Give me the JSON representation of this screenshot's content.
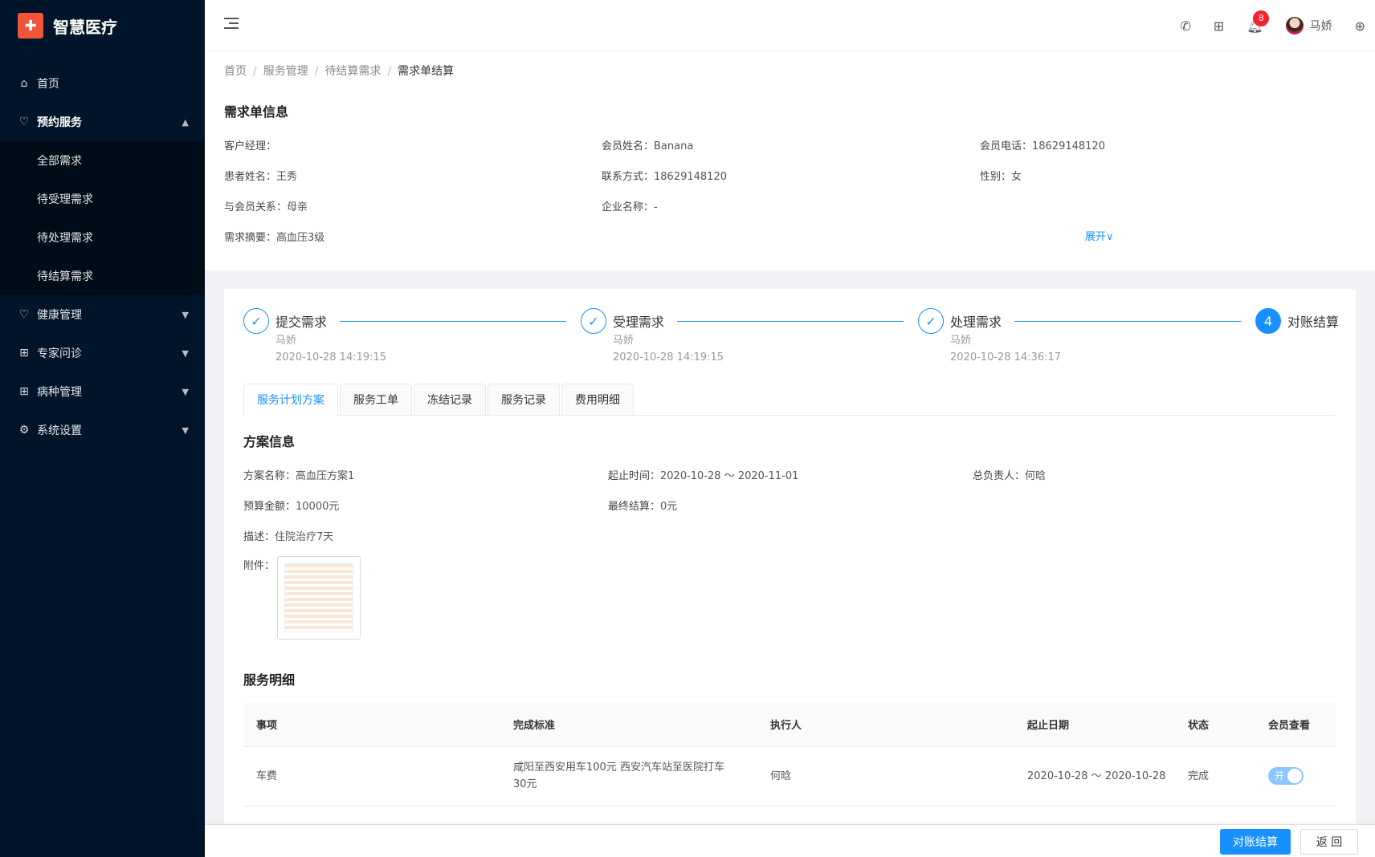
{
  "app": {
    "name": "智慧医疗"
  },
  "sidebar": {
    "items": [
      {
        "label": "首页",
        "icon": "home-icon"
      },
      {
        "label": "预约服务",
        "icon": "heart-shield-icon",
        "open": true,
        "children": [
          "全部需求",
          "待受理需求",
          "待处理需求",
          "待结算需求"
        ]
      },
      {
        "label": "健康管理",
        "icon": "heart-pulse-icon"
      },
      {
        "label": "专家问诊",
        "icon": "medical-plus-icon"
      },
      {
        "label": "病种管理",
        "icon": "medical-plus-icon"
      },
      {
        "label": "系统设置",
        "icon": "gear-icon"
      }
    ]
  },
  "header": {
    "notification_count": "8",
    "user_name": "马娇"
  },
  "breadcrumb": [
    "首页",
    "服务管理",
    "待结算需求",
    "需求单结算"
  ],
  "demand": {
    "title": "需求单信息",
    "fields": {
      "manager": {
        "label": "客户经理：",
        "value": ""
      },
      "member_name": {
        "label": "会员姓名：",
        "value": "Banana"
      },
      "member_phone": {
        "label": "会员电话：",
        "value": "18629148120"
      },
      "patient_name": {
        "label": "患者姓名：",
        "value": "王秀"
      },
      "contact": {
        "label": "联系方式：",
        "value": "18629148120"
      },
      "gender": {
        "label": "性别：",
        "value": "女"
      },
      "relation": {
        "label": "与会员关系：",
        "value": "母亲"
      },
      "company": {
        "label": "企业名称：",
        "value": "-"
      },
      "summary": {
        "label": "需求摘要：",
        "value": "高血压3级"
      }
    },
    "expand_label": "展开"
  },
  "steps": [
    {
      "title": "提交需求",
      "user": "马娇",
      "time": "2020-10-28 14:19:15",
      "status": "done"
    },
    {
      "title": "受理需求",
      "user": "马娇",
      "time": "2020-10-28 14:19:15",
      "status": "done"
    },
    {
      "title": "处理需求",
      "user": "马娇",
      "time": "2020-10-28 14:36:17",
      "status": "done"
    },
    {
      "title": "对账结算",
      "number": "4",
      "status": "active"
    }
  ],
  "tabs": [
    "服务计划方案",
    "服务工单",
    "冻结记录",
    "服务记录",
    "费用明细"
  ],
  "plan": {
    "title": "方案信息",
    "fields": {
      "name": {
        "label": "方案名称：",
        "value": "高血压方案1"
      },
      "period": {
        "label": "起止时间：",
        "value": "2020-10-28 ～ 2020-11-01"
      },
      "owner": {
        "label": "总负责人：",
        "value": "何晗"
      },
      "budget": {
        "label": "预算金额：",
        "value": "10000元"
      },
      "final": {
        "label": "最终结算：",
        "value": "0元"
      },
      "desc": {
        "label": "描述：",
        "value": "住院治疗7天"
      }
    },
    "attachment_label": "附件："
  },
  "service_detail": {
    "title": "服务明细",
    "columns": [
      "事项",
      "完成标准",
      "执行人",
      "起止日期",
      "状态",
      "会员查看"
    ],
    "rows": [
      {
        "item": "车费",
        "standard": "咸阳至西安用车100元 西安汽车站至医院打车30元",
        "executor": "何晗",
        "dates": "2020-10-28 ～ 2020-10-28",
        "status": "完成",
        "visible": "开"
      }
    ]
  },
  "footer": {
    "settle_label": "对账结算",
    "back_label": "返 回"
  },
  "colors": {
    "sidebar": "#001529",
    "primary": "#1890ff",
    "logo": "#f0553a",
    "badge": "#f5222d"
  }
}
